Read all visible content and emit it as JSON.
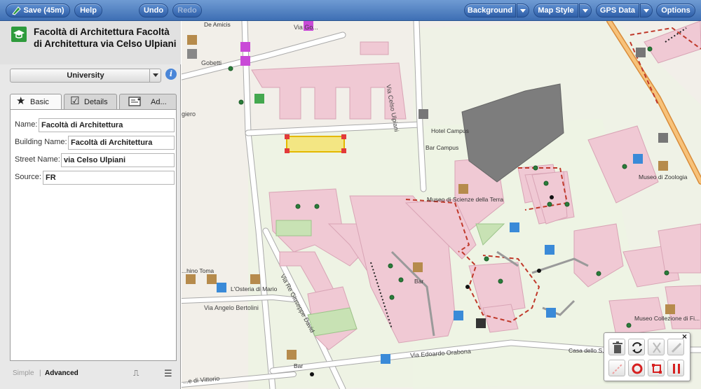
{
  "toolbar": {
    "save_label": "Save (45m)",
    "help_label": "Help",
    "undo_label": "Undo",
    "redo_label": "Redo",
    "background_label": "Background",
    "map_style_label": "Map Style",
    "gps_data_label": "GPS Data",
    "options_label": "Options"
  },
  "panel": {
    "title": "Facoltà di Architettura Facoltà di Architettura via Celso Ulpiani",
    "preset": "University",
    "tabs": [
      {
        "label": "Basic",
        "icon": "star-icon"
      },
      {
        "label": "Details",
        "icon": "checkbox-icon"
      },
      {
        "label": "Ad...",
        "icon": "advanced-tags-icon"
      }
    ],
    "fields": [
      {
        "label": "Name:",
        "value": "Facoltà di Architettura"
      },
      {
        "label": "Building Name:",
        "value": "Facoltà di Architettura"
      },
      {
        "label": "Street Name:",
        "value": "via Celso Ulpiani"
      },
      {
        "label": "Source:",
        "value": "FR"
      }
    ],
    "footer": {
      "simple": "Simple",
      "separator": "|",
      "advanced": "Advanced"
    }
  },
  "map": {
    "labels": {
      "de_amicis": "De Amicis",
      "via_goffredo": "Via Go...",
      "gobetti": "Gobetti",
      "giero": "giero",
      "via_celso_ulpiani": "Via Celso Ulpiani",
      "hotel_campus": "Hotel Campus",
      "bar_campus": "Bar Campus",
      "museo_zoologia": "Museo di Zoologia",
      "museo_scienze": "Museo di Scienze della Terra",
      "osteria": "L'Osteria di Mario",
      "angelo_bertolini": "Via Angelo Bertolini",
      "giuseppe_davi": "Via Re Giuseppe David",
      "edoardo_orabona": "Via Edoardo Orabona",
      "vittorio": "...e di Vittorio",
      "casa_dello": "Casa dello S...",
      "museo_collezione": "Museo Collezione di Fi...",
      "toma": "...hino Toma",
      "bar": "Bar",
      "bar_2": "Bar"
    },
    "colors": {
      "building": "#f0c9d4",
      "building_stroke": "#d8a4b5",
      "campus_area": "#eef3e4",
      "landuse_grey": "#7d7d7d",
      "road": "#ffffff",
      "road_stroke": "#aaaaaa",
      "footway": "#c0392b",
      "selected": "#f5e05a"
    }
  },
  "palette": {
    "tools": [
      "delete-icon",
      "reverse-icon",
      "split-icon",
      "disconnect-icon",
      "straighten-icon",
      "circularise-icon",
      "square-icon",
      "quadrilateralise-icon"
    ]
  }
}
